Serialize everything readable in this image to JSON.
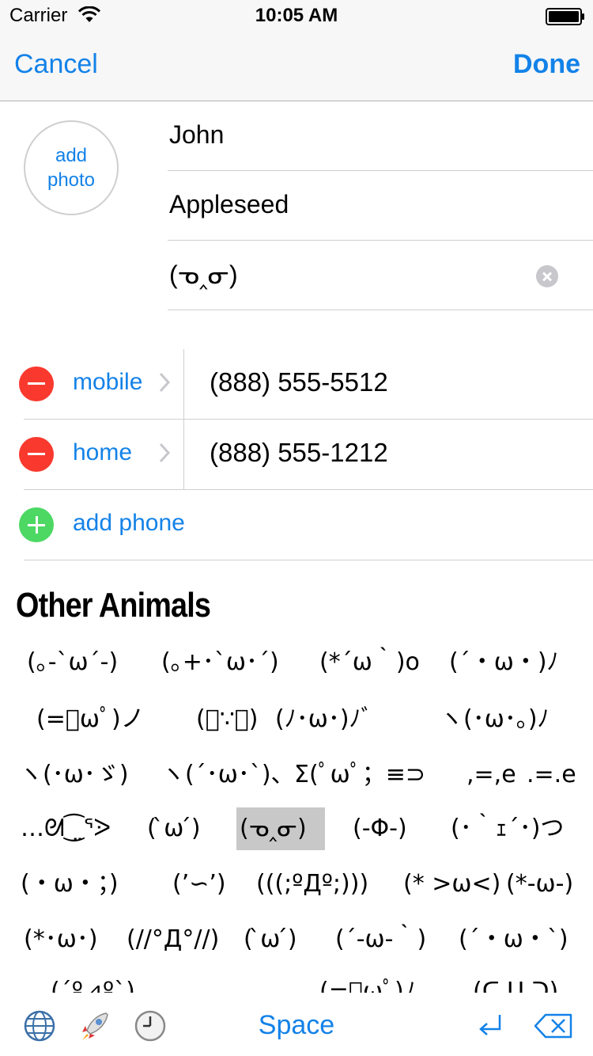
{
  "status_bar": {
    "carrier": "Carrier",
    "time": "10:05 AM"
  },
  "nav": {
    "cancel": "Cancel",
    "done": "Done"
  },
  "photo": {
    "line1": "add",
    "line2": "photo"
  },
  "name_fields": {
    "first": "John",
    "last": "Appleseed",
    "company": "(ᓀ‸ᓂ)"
  },
  "phones": [
    {
      "label": "mobile",
      "value": "(888) 555-5512"
    },
    {
      "label": "home",
      "value": "(888) 555-1212"
    }
  ],
  "add_phone": "add phone",
  "keyboard": {
    "category": "Other Animals",
    "rows": [
      [
        "(｡-`ω´-)",
        "(｡+･`ω･´)",
        "(*´ω｀)o",
        "(´・ω・)ﾉ"
      ],
      [
        "(=ﾟωﾟ)ノ",
        "(ﾟ∵ﾟ)",
        "(ﾉ･ω･)ﾉﾞ",
        "ヽ(･ω･｡)ﾉ"
      ],
      [
        "ヽ(･ω･ゞ)",
        "ヽ(´･ω･`)、",
        "Σ(ﾟωﾟ；≡⊃",
        ",=,e",
        ".=.e"
      ],
      [
        "…ᘛ⁐̤ᕐᐷ",
        "( ̀ω ́)",
        "(ᓀ‸ᓂ)",
        "(-Φ-)",
        "(･｀ｪ´･)つ"
      ],
      [
        "(・ω・；)",
        "(’∽’)",
        "(((;ºДº;)))",
        "(* >ω<)",
        "(*-ω-)"
      ],
      [
        "(*･ω･)",
        "(//°Д°//)",
        "( ̀ω ́)",
        "(´-ω-｀)",
        "(´・ω・`)"
      ],
      [
        "(´º⊿º`)",
        "(=ﾟωﾟ)ﾉ",
        "(ᑕ ᑌ ᑐ)"
      ]
    ],
    "selected": "(ᓀ‸ᓂ)",
    "space": "Space"
  },
  "colors": {
    "accent": "#1382e8",
    "delete": "#f9392e",
    "add": "#4cd863",
    "separator": "#cfcfcf"
  }
}
